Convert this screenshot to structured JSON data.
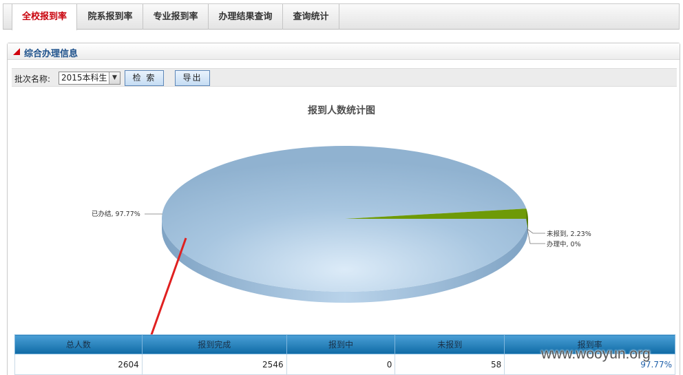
{
  "tabs": [
    {
      "label": "全校报到率",
      "active": true
    },
    {
      "label": "院系报到率",
      "active": false
    },
    {
      "label": "专业报到率",
      "active": false
    },
    {
      "label": "办理结果查询",
      "active": false
    },
    {
      "label": "查询统计",
      "active": false
    }
  ],
  "panel": {
    "title": "综合办理信息"
  },
  "filter": {
    "label": "批次名称:",
    "batch_value": "2015本科生",
    "search_label": "检 索",
    "export_label": "导出"
  },
  "chart_data": {
    "type": "pie",
    "title": "报到人数统计图",
    "slices": [
      {
        "name": "已办结",
        "percent": 97.77,
        "label": "已办结, 97.77%",
        "color": "#93b5d3"
      },
      {
        "name": "未报到",
        "percent": 2.23,
        "label": "未报到, 2.23%",
        "color": "#6e9a07"
      },
      {
        "name": "办理中",
        "percent": 0,
        "label": "办理中, 0%",
        "color": "#c08a20"
      }
    ],
    "style": "3d"
  },
  "table": {
    "headers": [
      "总人数",
      "报到完成",
      "报到中",
      "未报到",
      "报到率"
    ],
    "rows": [
      [
        "2604",
        "2546",
        "0",
        "58",
        "97.77%"
      ]
    ]
  },
  "watermark": "www.wooyun.org",
  "colors": {
    "active_tab": "#c8000a",
    "header_blue": "#0f6aa5",
    "accent_red": "#d0000c"
  }
}
